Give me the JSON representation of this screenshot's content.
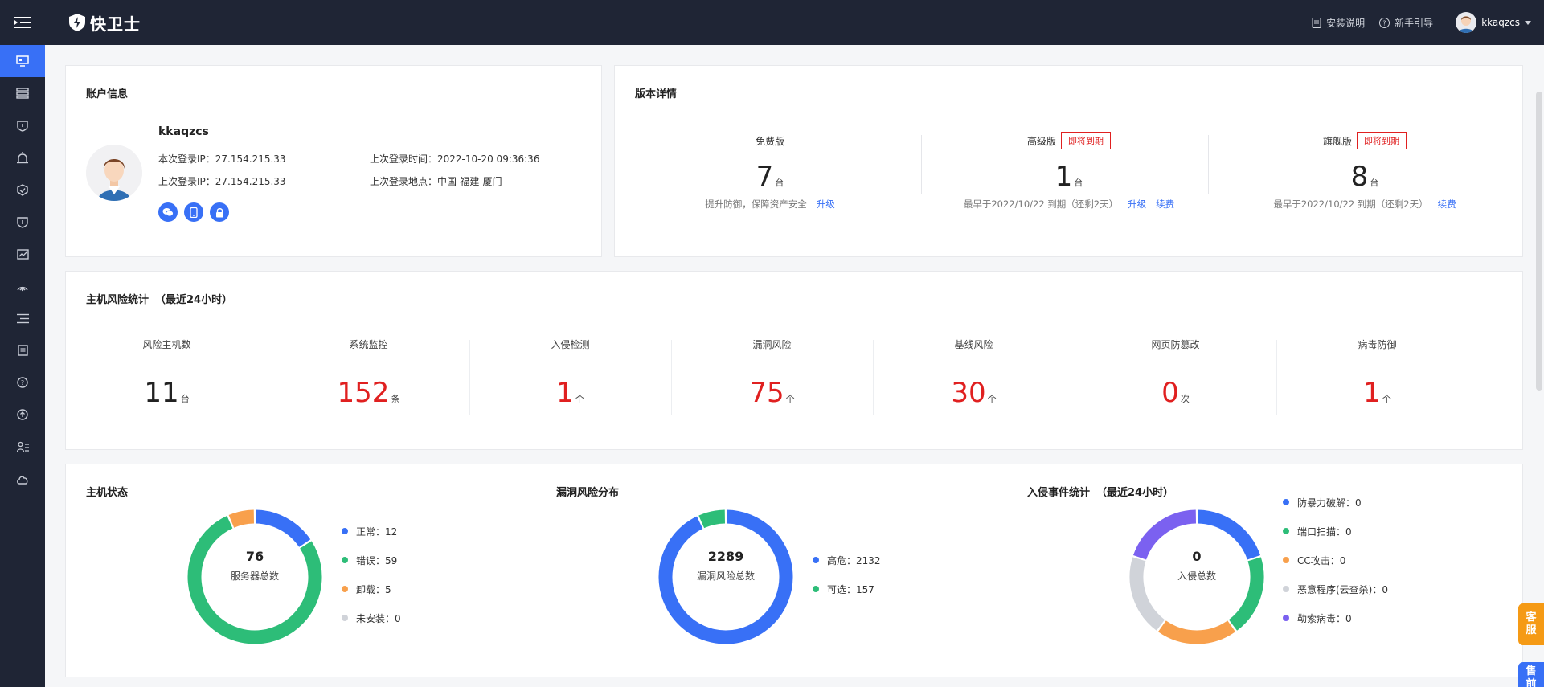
{
  "app": {
    "logo_text": "快卫士",
    "install_guide": "安装说明",
    "new_user_guide": "新手引导",
    "username": "kkaqzcs"
  },
  "sidebar": {
    "items": [
      "monitor-icon",
      "server-list-icon",
      "shield-alert-icon",
      "alarm-icon",
      "shield-check-icon",
      "shield-info-icon",
      "calendar-chart-icon",
      "signal-icon",
      "list-icon",
      "log-icon",
      "help-icon",
      "upload-icon",
      "user-list-icon",
      "cloud-icon"
    ],
    "active_index": 0
  },
  "account": {
    "title": "账户信息",
    "username": "kkaqzcs",
    "current_ip": "本次登录IP：27.154.215.33",
    "last_ip": "上次登录IP：27.154.215.33",
    "last_time": "上次登录时间：2022-10-20 09:36:36",
    "last_location": "上次登录地点：中国-福建-厦门"
  },
  "version": {
    "title": "版本详情",
    "free": {
      "name": "免费版",
      "count": "7",
      "unit": "台",
      "desc": "提升防御，保障资产安全",
      "link1": "升级"
    },
    "advanced": {
      "name": "高级版",
      "tag": "即将到期",
      "count": "1",
      "unit": "台",
      "desc": "最早于2022/10/22 到期（还剩2天）",
      "link1": "升级",
      "link2": "续费"
    },
    "flagship": {
      "name": "旗舰版",
      "tag": "即将到期",
      "count": "8",
      "unit": "台",
      "desc": "最早于2022/10/22 到期（还剩2天）",
      "link2": "续费"
    }
  },
  "risk": {
    "title": "主机风险统计",
    "subtitle": "（最近24小时）",
    "items": [
      {
        "label": "风险主机数",
        "value": "11",
        "unit": "台",
        "alert": false
      },
      {
        "label": "系统监控",
        "value": "152",
        "unit": "条",
        "alert": true
      },
      {
        "label": "入侵检测",
        "value": "1",
        "unit": "个",
        "alert": true
      },
      {
        "label": "漏洞风险",
        "value": "75",
        "unit": "个",
        "alert": true
      },
      {
        "label": "基线风险",
        "value": "30",
        "unit": "个",
        "alert": true
      },
      {
        "label": "网页防篡改",
        "value": "0",
        "unit": "次",
        "alert": true
      },
      {
        "label": "病毒防御",
        "value": "1",
        "unit": "个",
        "alert": true
      }
    ]
  },
  "status_charts": {
    "host_status": {
      "title": "主机状态",
      "total": "76",
      "total_label": "服务器总数",
      "legend": [
        "正常：12",
        "错误：59",
        "卸载：5",
        "未安装：0"
      ]
    },
    "vuln": {
      "title": "漏洞风险分布",
      "total": "2289",
      "total_label": "漏洞风险总数",
      "legend": [
        "高危：2132",
        "可选：157"
      ]
    },
    "intrusion": {
      "title": "入侵事件统计",
      "subtitle": "（最近24小时）",
      "total": "0",
      "total_label": "入侵总数",
      "legend": [
        "防暴力破解：0",
        "端口扫描：0",
        "CC攻击：0",
        "恶意程序(云查杀)：0",
        "勒索病毒：0"
      ]
    }
  },
  "chart_data": [
    {
      "type": "pie",
      "categories": [
        "正常",
        "错误",
        "卸载",
        "未安装"
      ],
      "values": [
        12,
        59,
        5,
        0
      ],
      "colors": [
        "#3870f6",
        "#2dbd78",
        "#f8a04c",
        "#d0d3d9"
      ]
    },
    {
      "type": "pie",
      "categories": [
        "高危",
        "可选"
      ],
      "values": [
        2132,
        157
      ],
      "colors": [
        "#3870f6",
        "#2dbd78"
      ]
    },
    {
      "type": "pie",
      "categories": [
        "防暴力破解",
        "端口扫描",
        "CC攻击",
        "恶意程序(云查杀)",
        "勒索病毒"
      ],
      "values": [
        0,
        0,
        0,
        0,
        0
      ],
      "colors": [
        "#3870f6",
        "#2dbd78",
        "#f8a04c",
        "#d0d3d9",
        "#7b61f0"
      ]
    }
  ],
  "float_buttons": {
    "service": "客服",
    "presale": "售前"
  },
  "colors": {
    "primary": "#3870f6",
    "danger": "#e02020",
    "dark": "#1f2535"
  }
}
